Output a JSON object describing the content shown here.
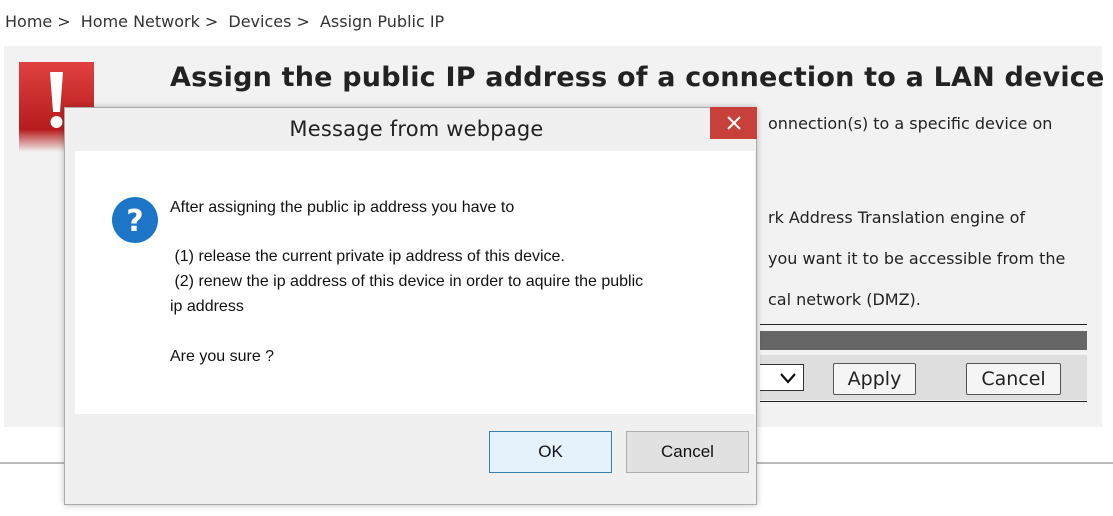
{
  "breadcrumb": {
    "items": [
      "Home",
      "Home Network",
      "Devices",
      "Assign Public IP"
    ],
    "separator": ">"
  },
  "page": {
    "title": "Assign the public IP address of a connection to a LAN device",
    "description_visible_fragments": [
      "onnection(s) to a specific device on",
      "rk Address Translation engine of",
      "you want it to be accessible from the",
      "cal network (DMZ)."
    ],
    "apply_label": "Apply",
    "cancel_label": "Cancel"
  },
  "dialog": {
    "title": "Message from webpage",
    "close_label": "✕",
    "icon": "question-icon",
    "message": {
      "line1": "After assigning the public ip address you have to",
      "line2": " (1) release the current private ip address of this device.",
      "line3": " (2) renew the ip address of this device in order to aquire the public",
      "line4": "ip address",
      "line5": "Are you sure ?"
    },
    "ok_label": "OK",
    "cancel_label": "Cancel"
  },
  "colors": {
    "close_button": "#c7413a",
    "question_icon": "#1c75c7",
    "warning_icon": "#c62828",
    "panel_bg": "#f2f2f2"
  }
}
